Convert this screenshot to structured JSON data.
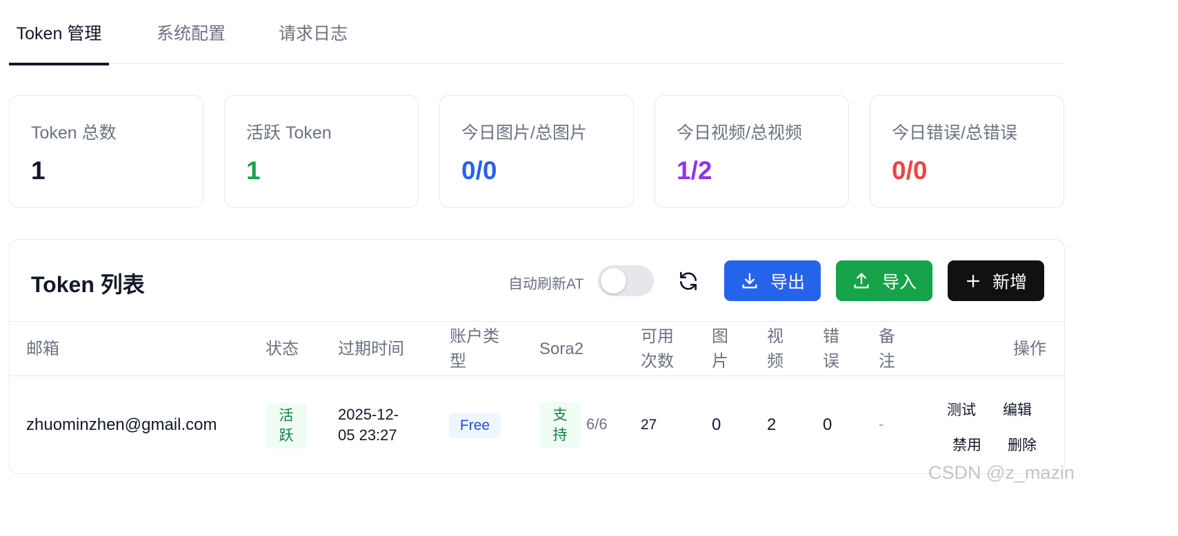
{
  "tabs": [
    {
      "label": "Token 管理",
      "active": true
    },
    {
      "label": "系统配置",
      "active": false
    },
    {
      "label": "请求日志",
      "active": false
    }
  ],
  "stats": [
    {
      "label": "Token 总数",
      "value": "1",
      "color": "#111827"
    },
    {
      "label": "活跃 Token",
      "value": "1",
      "color": "#16a34a"
    },
    {
      "label": "今日图片/总图片",
      "value": "0/0",
      "color": "#2563eb"
    },
    {
      "label": "今日视频/总视频",
      "value": "1/2",
      "color": "#9333ea"
    },
    {
      "label": "今日错误/总错误",
      "value": "0/0",
      "color": "#ef4444"
    }
  ],
  "list": {
    "title": "Token 列表",
    "auto_refresh_label": "自动刷新AT",
    "auto_refresh_on": false,
    "refresh_icon": "refresh-icon",
    "buttons": {
      "export": "导出",
      "import": "导入",
      "add": "新增"
    },
    "colors": {
      "export": "#2563eb",
      "import": "#16a34a",
      "add": "#111111"
    }
  },
  "table": {
    "headers": {
      "email": "邮箱",
      "status": "状态",
      "expire_1": "过期时间",
      "account_type_1": "账户类",
      "account_type_2": "型",
      "sora2": "Sora2",
      "remaining_1": "可用",
      "remaining_2": "次数",
      "image_1": "图",
      "image_2": "片",
      "video_1": "视",
      "video_2": "频",
      "error_1": "错",
      "error_2": "误",
      "note_1": "备",
      "note_2": "注",
      "actions": "操作"
    },
    "rows": [
      {
        "email": "zhuominzhen@gmail.com",
        "status_1": "活",
        "status_2": "跃",
        "expire_1": "2025-12-",
        "expire_2": "05 23:27",
        "account_type": "Free",
        "sora2_1": "支",
        "sora2_2": "持",
        "sora2_quota": "6/6",
        "remaining": "27",
        "images": "0",
        "videos": "2",
        "errors": "0",
        "note": "-",
        "actions": {
          "test": "测试",
          "edit": "编辑",
          "disable": "禁用",
          "delete": "删除"
        }
      }
    ]
  },
  "watermark": "CSDN @z_mazin"
}
